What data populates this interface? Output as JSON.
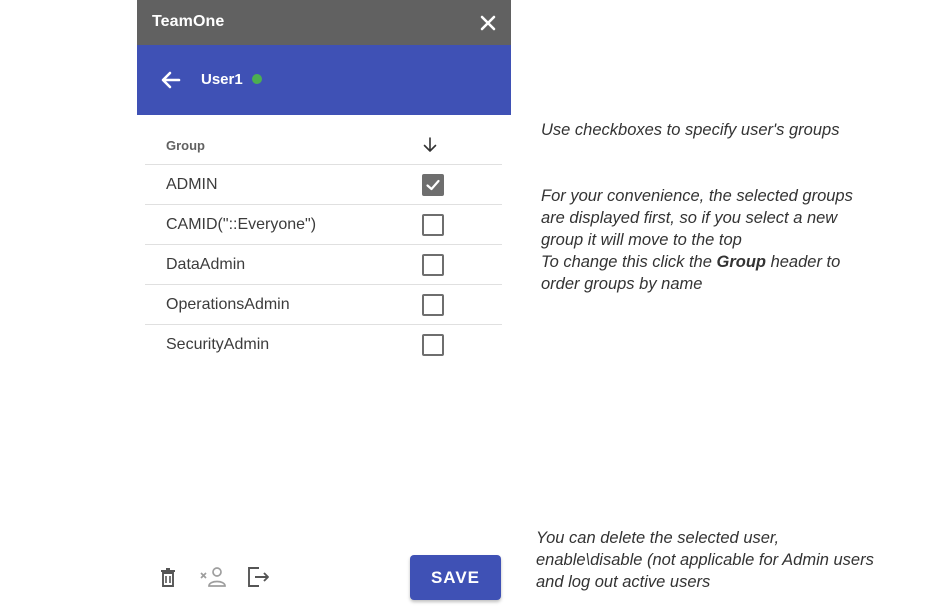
{
  "titlebar": {
    "title": "TeamOne",
    "close_icon": "close-icon"
  },
  "userbar": {
    "user_name": "User1",
    "status_color": "#4caf50"
  },
  "table": {
    "header": {
      "group_label": "Group",
      "sort_icon": "arrow-down-icon"
    },
    "rows": [
      {
        "name": "ADMIN",
        "checked": true
      },
      {
        "name": "CAMID(\"::Everyone\")",
        "checked": false
      },
      {
        "name": "DataAdmin",
        "checked": false
      },
      {
        "name": "OperationsAdmin",
        "checked": false
      },
      {
        "name": "SecurityAdmin",
        "checked": false
      }
    ]
  },
  "footer": {
    "icons": [
      "trash-icon",
      "disable-user-icon",
      "logout-icon"
    ],
    "save_label": "SAVE"
  },
  "notes": {
    "checkbox_hint": "Use checkboxes to specify user's groups",
    "order_hint_1": "For your convenience, the selected groups",
    "order_hint_2": "are displayed first, so if you select a new",
    "order_hint_3": "group it will move to the top",
    "order_hint_4a": "To change this click the ",
    "order_hint_4b": "Group",
    "order_hint_4c": " header to",
    "order_hint_5": "order groups by name",
    "actions_hint_1": "You can delete the selected user,",
    "actions_hint_2": "enable\\disable (not applicable for Admin users",
    "actions_hint_3": "and log out active users"
  },
  "colors": {
    "titlebar": "#616161",
    "accent": "#3f51b5"
  }
}
